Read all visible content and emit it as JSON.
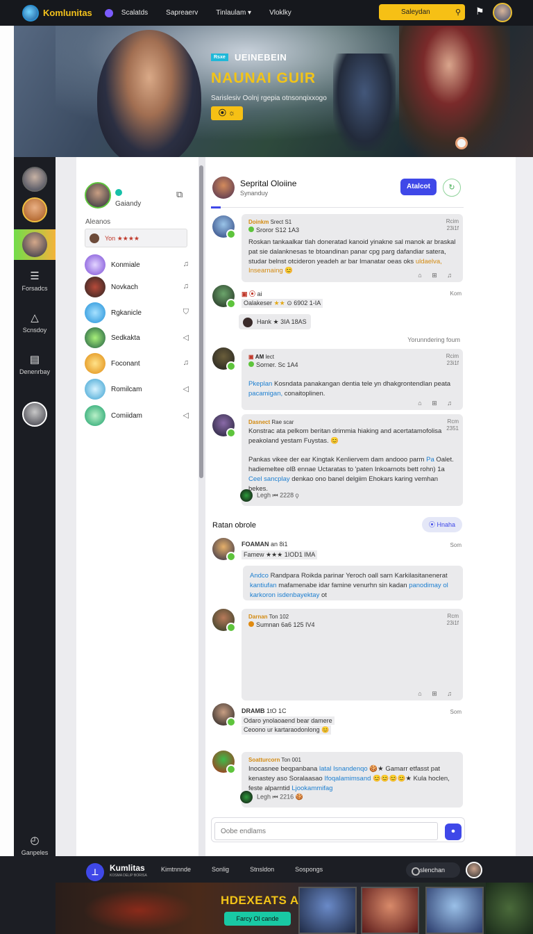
{
  "topnav": {
    "brand": "Komlunitas",
    "links": [
      "Scalatds",
      "Sapreaerv",
      "Tinlaulam ▾",
      "Vloklky"
    ],
    "search_placeholder": "Saleydan",
    "icons": [
      "logo-badge",
      "nav-dot",
      "search-icon",
      "bell-icon",
      "user-avatar"
    ]
  },
  "hero": {
    "tag": "Rsxe",
    "sub_title": "UEINEBEIN",
    "title": "NAUNAI GUIR",
    "description": "Sarislesiv Oolnj rgepia otnsonqixxogo",
    "button_label": "⦿ ☼"
  },
  "rail": {
    "items": [
      {
        "label": "Forsadcs",
        "icon": "list-icon"
      },
      {
        "label": "Scnsdoy",
        "icon": "triangle-icon"
      },
      {
        "label": "Denenrbay",
        "icon": "document-icon"
      },
      {
        "label": "Ganpeles",
        "icon": "compass-icon"
      }
    ]
  },
  "side": {
    "me_name": "Gaiandy",
    "section_label": "Aleanos",
    "active_item": "Yon ★★★★",
    "items": [
      {
        "name": "Konmiale",
        "icon": "♫",
        "color": "#7a4bd6"
      },
      {
        "name": "Novkach",
        "icon": "♫",
        "color": "#3a2e2a"
      },
      {
        "name": "Rgkanicle",
        "icon": "⛉",
        "color": "#1f8fd8"
      },
      {
        "name": "Sedkakta",
        "icon": "◁",
        "color": "#2e9b3c"
      },
      {
        "name": "Foconant",
        "icon": "♫",
        "color": "#f0a018"
      },
      {
        "name": "Romilcam",
        "icon": "◁",
        "color": "#3aa0d0"
      },
      {
        "name": "Comiidam",
        "icon": "◁",
        "color": "#1aa06a"
      }
    ]
  },
  "chat": {
    "title": "Seprital Oloiine",
    "subtitle": "Synanduy",
    "button_label": "Atalcot",
    "messages": [
      {
        "name": "Doinkm",
        "meta": "Srect S1",
        "sub": "Sroror S12 1A3",
        "time": "Rcim\n23i1f",
        "body_parts": [
          {
            "t": "Roskan tankaalkar tlah doneratad kanoid yinakne sal manok ar braskal pat sie dalanknesas te btoandinan panar cpg parg dafandiar satera, studar belnst otcideron yeadeh ar bar Imanatar oeas oks "
          },
          {
            "t": "uldaelva,",
            "c": "hl2"
          },
          {
            "t": " Insearnaing ",
            "c": "hl2"
          },
          {
            "t": "😊"
          }
        ],
        "actions": "⌂ ⊞ ♫"
      },
      {
        "name": "Oalakeser",
        "meta": "ai",
        "stars": "★★",
        "extra": "⊙ 6902 1-IA",
        "time": "Kom",
        "pill": "Hank ★ 3IA 18AS"
      },
      {
        "note": "Yorunndering foum"
      },
      {
        "name": "AM",
        "meta": "lect",
        "sub": "Sorner. Sc 1A4",
        "time": "Rcim\n23i1f",
        "body_parts": [
          {
            "t": "Pkeplan",
            "c": "hl"
          },
          {
            "t": " Kosndata panakangan dentia tele yn dhakgrontendlan peata "
          },
          {
            "t": "pacamigan,",
            "c": "hl"
          },
          {
            "t": " conaitoplinen."
          }
        ],
        "actions": "⌂ ⊞ ♫"
      },
      {
        "name": "Dasnect",
        "meta": "Rae scar",
        "time": "Rcm\n2351",
        "body_parts": [
          {
            "t": "Konstrac ata pelkom beritan drimmia hiaking and acertatamofolisa peakoland yestam Fuystas. 😊\n\nPankas vikee der ear Kingtak Kenliervem dam andooo parm "
          },
          {
            "t": "Pa",
            "c": "hl"
          },
          {
            "t": " Oalet. hadiemeltee olB ennae Uctaratas to 'paten Inkoarnots bett rohn) 1a "
          },
          {
            "t": "Ceel sancplay",
            "c": "hl"
          },
          {
            "t": " denkao ono banel delgiim Ehokars karing vemhan bekes."
          }
        ],
        "footer": "Legh    ⏮ 2228 ⚲"
      }
    ],
    "section_title": "Ratan obrole",
    "section_button": "Hnaha",
    "messages2": [
      {
        "name": "FOAMAN",
        "meta": "an 8i1",
        "sub": "Famew ★★★ 1IOD1 IMA",
        "time": "Som"
      },
      {
        "body_parts": [
          {
            "t": "Andco",
            "c": "hl"
          },
          {
            "t": " Randpara Roikda parinar Yeroch oall sarn Karkilasitanenerat "
          },
          {
            "t": "kantiufan",
            "c": "hl"
          },
          {
            "t": " mafamenabe idar famine venurhn sin kadan "
          },
          {
            "t": "panodimay ol",
            "c": "hl"
          },
          {
            "t": " "
          },
          {
            "t": "karkoron isdenbayektay",
            "c": "hl"
          },
          {
            "t": " ot"
          }
        ]
      },
      {
        "name": "Darnan",
        "meta": "Ton 102",
        "sub": "Sumnan 6a6 125 IV4",
        "time": "Rcm\n23i1f",
        "actions": "⌂ ⊞ ♫"
      },
      {
        "name": "DRAMB",
        "meta": "1tO 1C",
        "line1": "Odaro ynolaoaend bear damere",
        "line2": "Ceoono ur kartaraodonlong 😊",
        "time": "Som"
      },
      {
        "name": "Soatturcorn",
        "meta": "Ton 001",
        "body_parts": [
          {
            "t": "Inocasnee beqpanbana "
          },
          {
            "t": "latal Isnandenqo",
            "c": "hl"
          },
          {
            "t": " 🍪★ Gamarr etfasst pat kenastey aso Soralaasao "
          },
          {
            "t": "Ifoqalamimsand",
            "c": "hl"
          },
          {
            "t": " 😊😊😊😊★ Kula hoclen, feste alparntid "
          },
          {
            "t": "Ljookammifag",
            "c": "hl"
          }
        ],
        "footer": "Legh    ⏮ 2216 🍪"
      }
    ],
    "composer_placeholder": "Oobe endlams"
  },
  "bottomnav": {
    "brand": "Kumlitas",
    "brand_sub": "KOSMA DELIP  BORISA",
    "links": [
      "Kimtnnnde",
      "Sonlig",
      "Stnsldon",
      "Sospongs"
    ],
    "pill_label": "slenchan"
  },
  "promo": {
    "title": "HDEXEATS ANK",
    "button_label": "Farcy Ol cande"
  }
}
